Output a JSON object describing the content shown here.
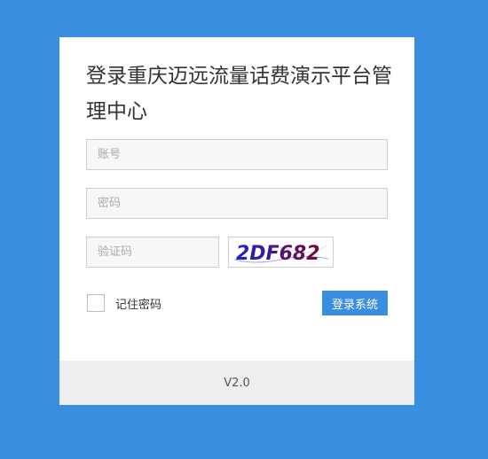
{
  "login": {
    "title": "登录重庆迈远流量话费演示平台管理中心",
    "account_placeholder": "账号",
    "password_placeholder": "密码",
    "captcha_placeholder": "验证码",
    "captcha_text": "2DF682",
    "remember_label": "记住密码",
    "remember_checked": false,
    "submit_label": "登录系统"
  },
  "footer": {
    "version": "V2.0"
  },
  "colors": {
    "background": "#3a8ee0",
    "accent": "#3a8ee0",
    "captcha_start": "#1a23c9",
    "captcha_end": "#7a0a3c"
  }
}
